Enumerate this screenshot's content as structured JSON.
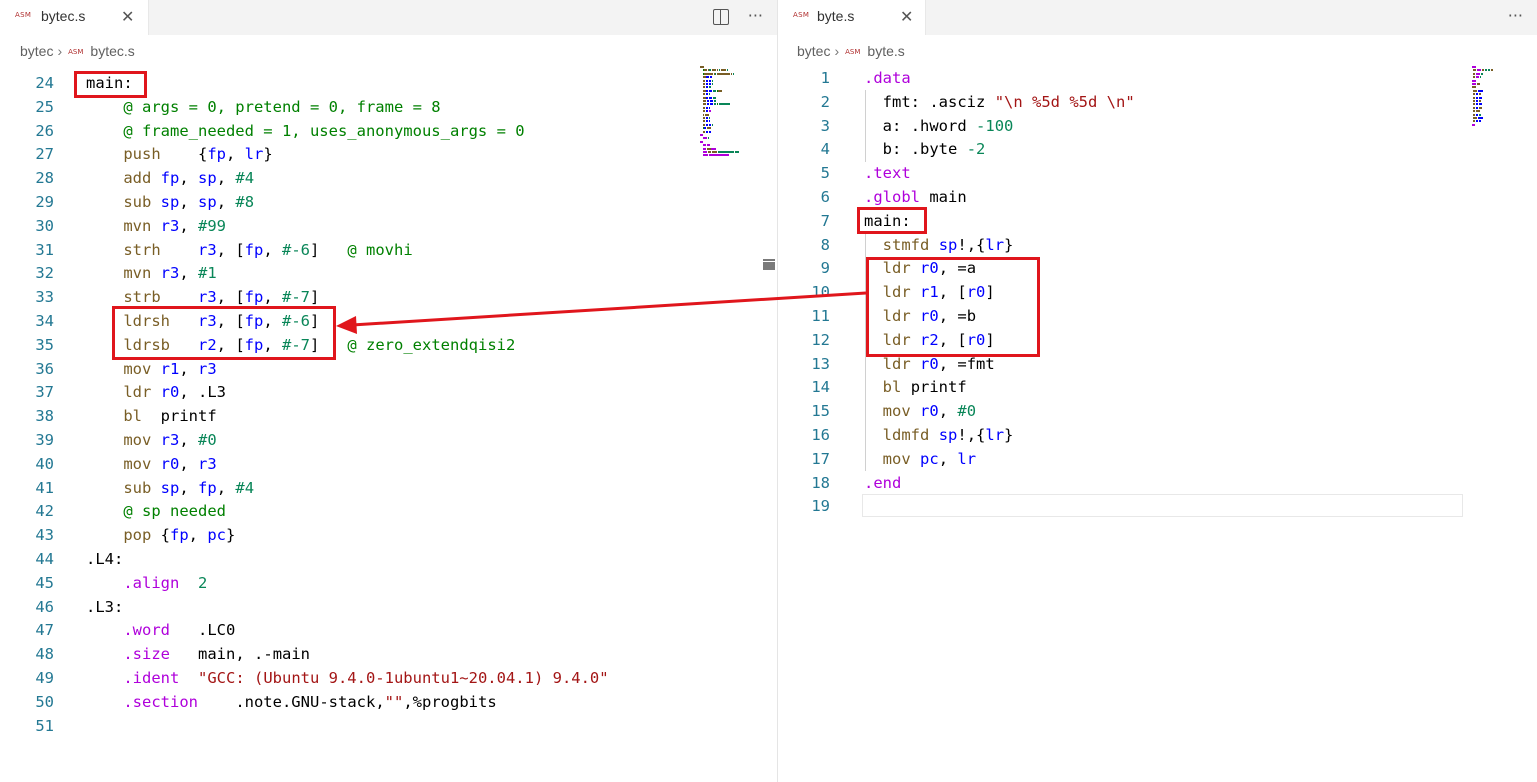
{
  "left": {
    "tab_label": "bytec.s",
    "tab_close": "✕",
    "asm_badge": "ASM",
    "breadcrumb": [
      "bytec",
      "bytec.s"
    ],
    "actions": {
      "split": "split-editor",
      "more": "···"
    },
    "lines": [
      {
        "n": "24",
        "t": "main:"
      },
      {
        "n": "25",
        "t": "    @ args = 0, pretend = 0, frame = 8"
      },
      {
        "n": "26",
        "t": "    @ frame_needed = 1, uses_anonymous_args = 0"
      },
      {
        "n": "27",
        "t": "    push    {fp, lr}"
      },
      {
        "n": "28",
        "t": "    add fp, sp, #4"
      },
      {
        "n": "29",
        "t": "    sub sp, sp, #8"
      },
      {
        "n": "30",
        "t": "    mvn r3, #99"
      },
      {
        "n": "31",
        "t": "    strh    r3, [fp, #-6]   @ movhi"
      },
      {
        "n": "32",
        "t": "    mvn r3, #1"
      },
      {
        "n": "33",
        "t": "    strb    r3, [fp, #-7]"
      },
      {
        "n": "34",
        "t": "    ldrsh   r3, [fp, #-6]"
      },
      {
        "n": "35",
        "t": "    ldrsb   r2, [fp, #-7]   @ zero_extendqisi2"
      },
      {
        "n": "36",
        "t": "    mov r1, r3"
      },
      {
        "n": "37",
        "t": "    ldr r0, .L3"
      },
      {
        "n": "38",
        "t": "    bl  printf"
      },
      {
        "n": "39",
        "t": "    mov r3, #0"
      },
      {
        "n": "40",
        "t": "    mov r0, r3"
      },
      {
        "n": "41",
        "t": "    sub sp, fp, #4"
      },
      {
        "n": "42",
        "t": "    @ sp needed"
      },
      {
        "n": "43",
        "t": "    pop {fp, pc}"
      },
      {
        "n": "44",
        "t": ".L4:"
      },
      {
        "n": "45",
        "t": "    .align  2"
      },
      {
        "n": "46",
        "t": ".L3:"
      },
      {
        "n": "47",
        "t": "    .word   .LC0"
      },
      {
        "n": "48",
        "t": "    .size   main, .-main"
      },
      {
        "n": "49",
        "t": "    .ident  \"GCC: (Ubuntu 9.4.0-1ubuntu1~20.04.1) 9.4.0\""
      },
      {
        "n": "50",
        "t": "    .section    .note.GNU-stack,\"\",%progbits"
      },
      {
        "n": "51",
        "t": ""
      }
    ]
  },
  "right": {
    "tab_label": "byte.s",
    "tab_close": "✕",
    "asm_badge": "ASM",
    "breadcrumb": [
      "bytec",
      "byte.s"
    ],
    "actions": {
      "more": "···"
    },
    "lines": [
      {
        "n": "1",
        "t": ".data"
      },
      {
        "n": "2",
        "t": "  fmt: .asciz \"\\n %5d %5d \\n\""
      },
      {
        "n": "3",
        "t": "  a: .hword -100"
      },
      {
        "n": "4",
        "t": "  b: .byte -2"
      },
      {
        "n": "5",
        "t": ".text"
      },
      {
        "n": "6",
        "t": ".globl main"
      },
      {
        "n": "7",
        "t": "main:"
      },
      {
        "n": "8",
        "t": "  stmfd sp!,{lr}"
      },
      {
        "n": "9",
        "t": "  ldr r0, =a"
      },
      {
        "n": "10",
        "t": "  ldr r1, [r0]"
      },
      {
        "n": "11",
        "t": "  ldr r0, =b"
      },
      {
        "n": "12",
        "t": "  ldr r2, [r0]"
      },
      {
        "n": "13",
        "t": "  ldr r0, =fmt"
      },
      {
        "n": "14",
        "t": "  bl printf"
      },
      {
        "n": "15",
        "t": "  mov r0, #0"
      },
      {
        "n": "16",
        "t": "  ldmfd sp!,{lr}"
      },
      {
        "n": "17",
        "t": "  mov pc, lr"
      },
      {
        "n": "18",
        "t": ".end"
      },
      {
        "n": "19",
        "t": ""
      }
    ]
  },
  "colors": {
    "highlight": "#e0161c",
    "line_number": "#237893",
    "mnemonic": "#795e26",
    "register": "#0000ff",
    "number": "#098658",
    "comment": "#008000",
    "directive": "#af00db",
    "string": "#a31515"
  }
}
